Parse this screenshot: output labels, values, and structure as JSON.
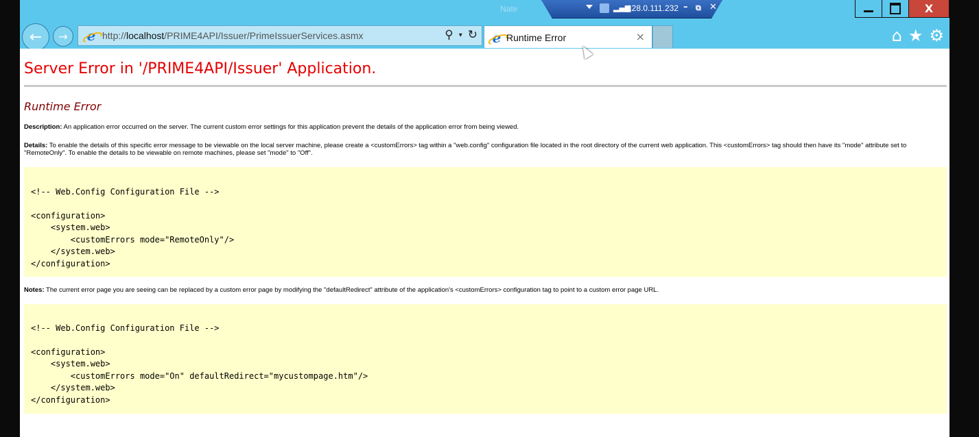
{
  "window": {
    "remote_session": {
      "label": "Nate",
      "ip": "128.0.111.232",
      "signal": "▂▄▆",
      "min": "–",
      "restore": "⧉",
      "close": "✕"
    },
    "controls": {
      "close_label": "X"
    }
  },
  "browser": {
    "back": "←",
    "forward": "→",
    "url_scheme": "http://",
    "url_host": "localhost",
    "url_path": "/PRIME4API/Issuer/PrimeIssuerServices.asmx",
    "search_icon": "⚲",
    "dropdown_icon": "▾",
    "refresh_icon": "↻",
    "tab_title": "Runtime Error",
    "tab_close": "×",
    "icons": {
      "home": "⌂",
      "favorites": "★",
      "tools": "⚙"
    }
  },
  "page": {
    "heading": "Server Error in '/PRIME4API/Issuer' Application.",
    "subheading": "Runtime Error",
    "description_label": "Description:",
    "description_text": " An application error occurred on the server. The current custom error settings for this application prevent the details of the application error from being viewed.",
    "details_label": "Details:",
    "details_text": " To enable the details of this specific error message to be viewable on the local server machine, please create a <customErrors> tag within a \"web.config\" configuration file located in the root directory of the current web application. This <customErrors> tag should then have its \"mode\" attribute set to \"RemoteOnly\". To enable the details to be viewable on remote machines, please set \"mode\" to \"Off\".",
    "code1": [
      "<!-- Web.Config Configuration File -->",
      "",
      "<configuration>",
      "    <system.web>",
      "        <customErrors mode=\"RemoteOnly\"/>",
      "    </system.web>",
      "</configuration>"
    ],
    "notes_label": "Notes:",
    "notes_text": " The current error page you are seeing can be replaced by a custom error page by modifying the \"defaultRedirect\" attribute of the application's <customErrors> configuration tag to point to a custom error page URL.",
    "code2": [
      "<!-- Web.Config Configuration File -->",
      "",
      "<configuration>",
      "    <system.web>",
      "        <customErrors mode=\"On\" defaultRedirect=\"mycustompage.htm\"/>",
      "    </system.web>",
      "</configuration>"
    ]
  },
  "colors": {
    "titlebar": "#5cc7ec",
    "heading": "#e50000",
    "subheading": "#800000",
    "codebox": "#ffffcc"
  }
}
